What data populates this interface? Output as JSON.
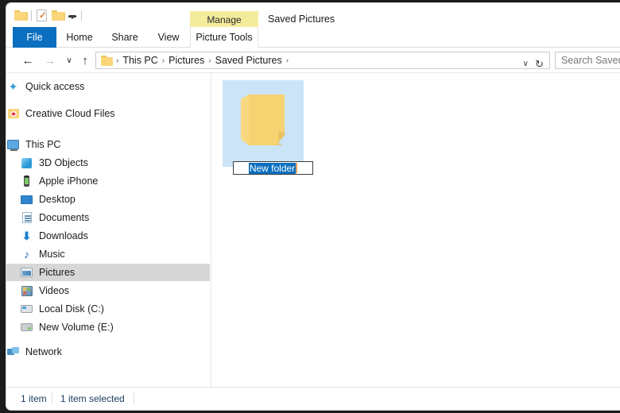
{
  "window": {
    "title": "Saved Pictures"
  },
  "quick_access_toolbar": {
    "items": [
      {
        "name": "folder-icon",
        "label": ""
      },
      {
        "name": "properties-icon",
        "label": ""
      },
      {
        "name": "new-folder-icon",
        "label": ""
      },
      {
        "name": "customize-caret-icon",
        "label": ""
      }
    ]
  },
  "contextual_tab": {
    "group_label": "Manage",
    "tools_label": "Picture Tools"
  },
  "ribbon": {
    "tabs": [
      {
        "label": "File",
        "active": true
      },
      {
        "label": "Home",
        "active": false
      },
      {
        "label": "Share",
        "active": false
      },
      {
        "label": "View",
        "active": false
      }
    ]
  },
  "address_bar": {
    "back_icon": "←",
    "forward_icon": "→",
    "recent_icon": "∨",
    "up_icon": "↑",
    "dropdown_icon": "∨",
    "refresh_icon": "↻",
    "breadcrumb": [
      {
        "label": "This PC"
      },
      {
        "label": "Pictures"
      },
      {
        "label": "Saved Pictures"
      }
    ],
    "separator": "›",
    "trailing_separator": "›"
  },
  "search": {
    "placeholder": "Search Saved Pictures"
  },
  "sidebar": {
    "items": [
      {
        "label": "Quick access",
        "icon": "star-icon",
        "indent": 0,
        "selected": false
      },
      {
        "label": "Creative Cloud Files",
        "icon": "creative-cloud-icon",
        "indent": 0,
        "selected": false
      },
      {
        "label": "This PC",
        "icon": "this-pc-icon",
        "indent": 0,
        "selected": false
      },
      {
        "label": "3D Objects",
        "icon": "3d-objects-icon",
        "indent": 1,
        "selected": false
      },
      {
        "label": "Apple iPhone",
        "icon": "phone-icon",
        "indent": 1,
        "selected": false
      },
      {
        "label": "Desktop",
        "icon": "desktop-icon",
        "indent": 1,
        "selected": false
      },
      {
        "label": "Documents",
        "icon": "documents-icon",
        "indent": 1,
        "selected": false
      },
      {
        "label": "Downloads",
        "icon": "downloads-icon",
        "indent": 1,
        "selected": false
      },
      {
        "label": "Music",
        "icon": "music-icon",
        "indent": 1,
        "selected": false
      },
      {
        "label": "Pictures",
        "icon": "pictures-icon",
        "indent": 1,
        "selected": true
      },
      {
        "label": "Videos",
        "icon": "videos-icon",
        "indent": 1,
        "selected": false
      },
      {
        "label": "Local Disk (C:)",
        "icon": "disk-icon",
        "indent": 1,
        "selected": false
      },
      {
        "label": "New Volume (E:)",
        "icon": "volume-icon",
        "indent": 1,
        "selected": false
      },
      {
        "label": "Network",
        "icon": "network-icon",
        "indent": 0,
        "selected": false
      }
    ],
    "icons": {
      "star": "★",
      "downloads": "⬇",
      "music": "♪"
    }
  },
  "content": {
    "items": [
      {
        "name": "New folder",
        "type": "folder",
        "selected": true,
        "renaming": true,
        "rename_value": "New folder",
        "rename_selected_all": true
      }
    ]
  },
  "status_bar": {
    "item_count": "1 item",
    "selection": "1 item selected"
  },
  "colors": {
    "accent": "#0b6fc0",
    "contextual_tab": "#f3ec9c",
    "selection_fill": "#cce4f7",
    "sidebar_selection": "#d7d7d7",
    "folder_yellow": "#fbd579"
  }
}
